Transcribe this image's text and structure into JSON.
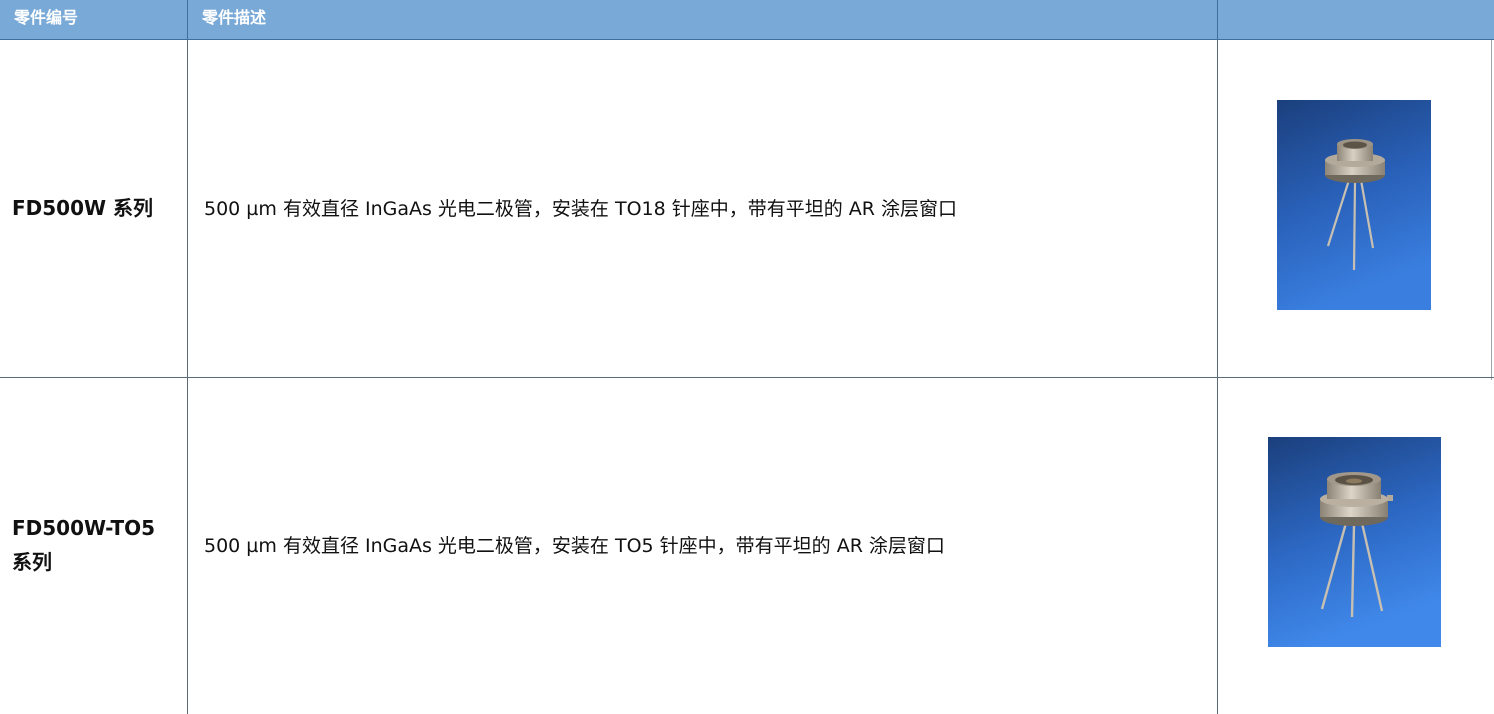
{
  "table": {
    "headers": [
      "零件编号",
      "零件描述",
      ""
    ],
    "rows": [
      {
        "part_number": "FD500W 系列",
        "description": "500 µm 有效直径 InGaAs 光电二极管，安装在 TO18 针座中，带有平坦的 AR 涂层窗口",
        "image_icon": "to18-photodiode-photo"
      },
      {
        "part_number": "FD500W-TO5 系列",
        "description": "500 µm 有效直径 InGaAs 光电二极管，安装在 TO5 针座中，带有平坦的 AR 涂层窗口",
        "image_icon": "to5-photodiode-photo"
      }
    ]
  },
  "colors": {
    "header_bg": "#79a9d6",
    "header_text": "#ffffff",
    "grid_line": "#5b6b78",
    "photo_bg_top": "#1f4f95",
    "photo_bg_bottom": "#3f86e6"
  }
}
